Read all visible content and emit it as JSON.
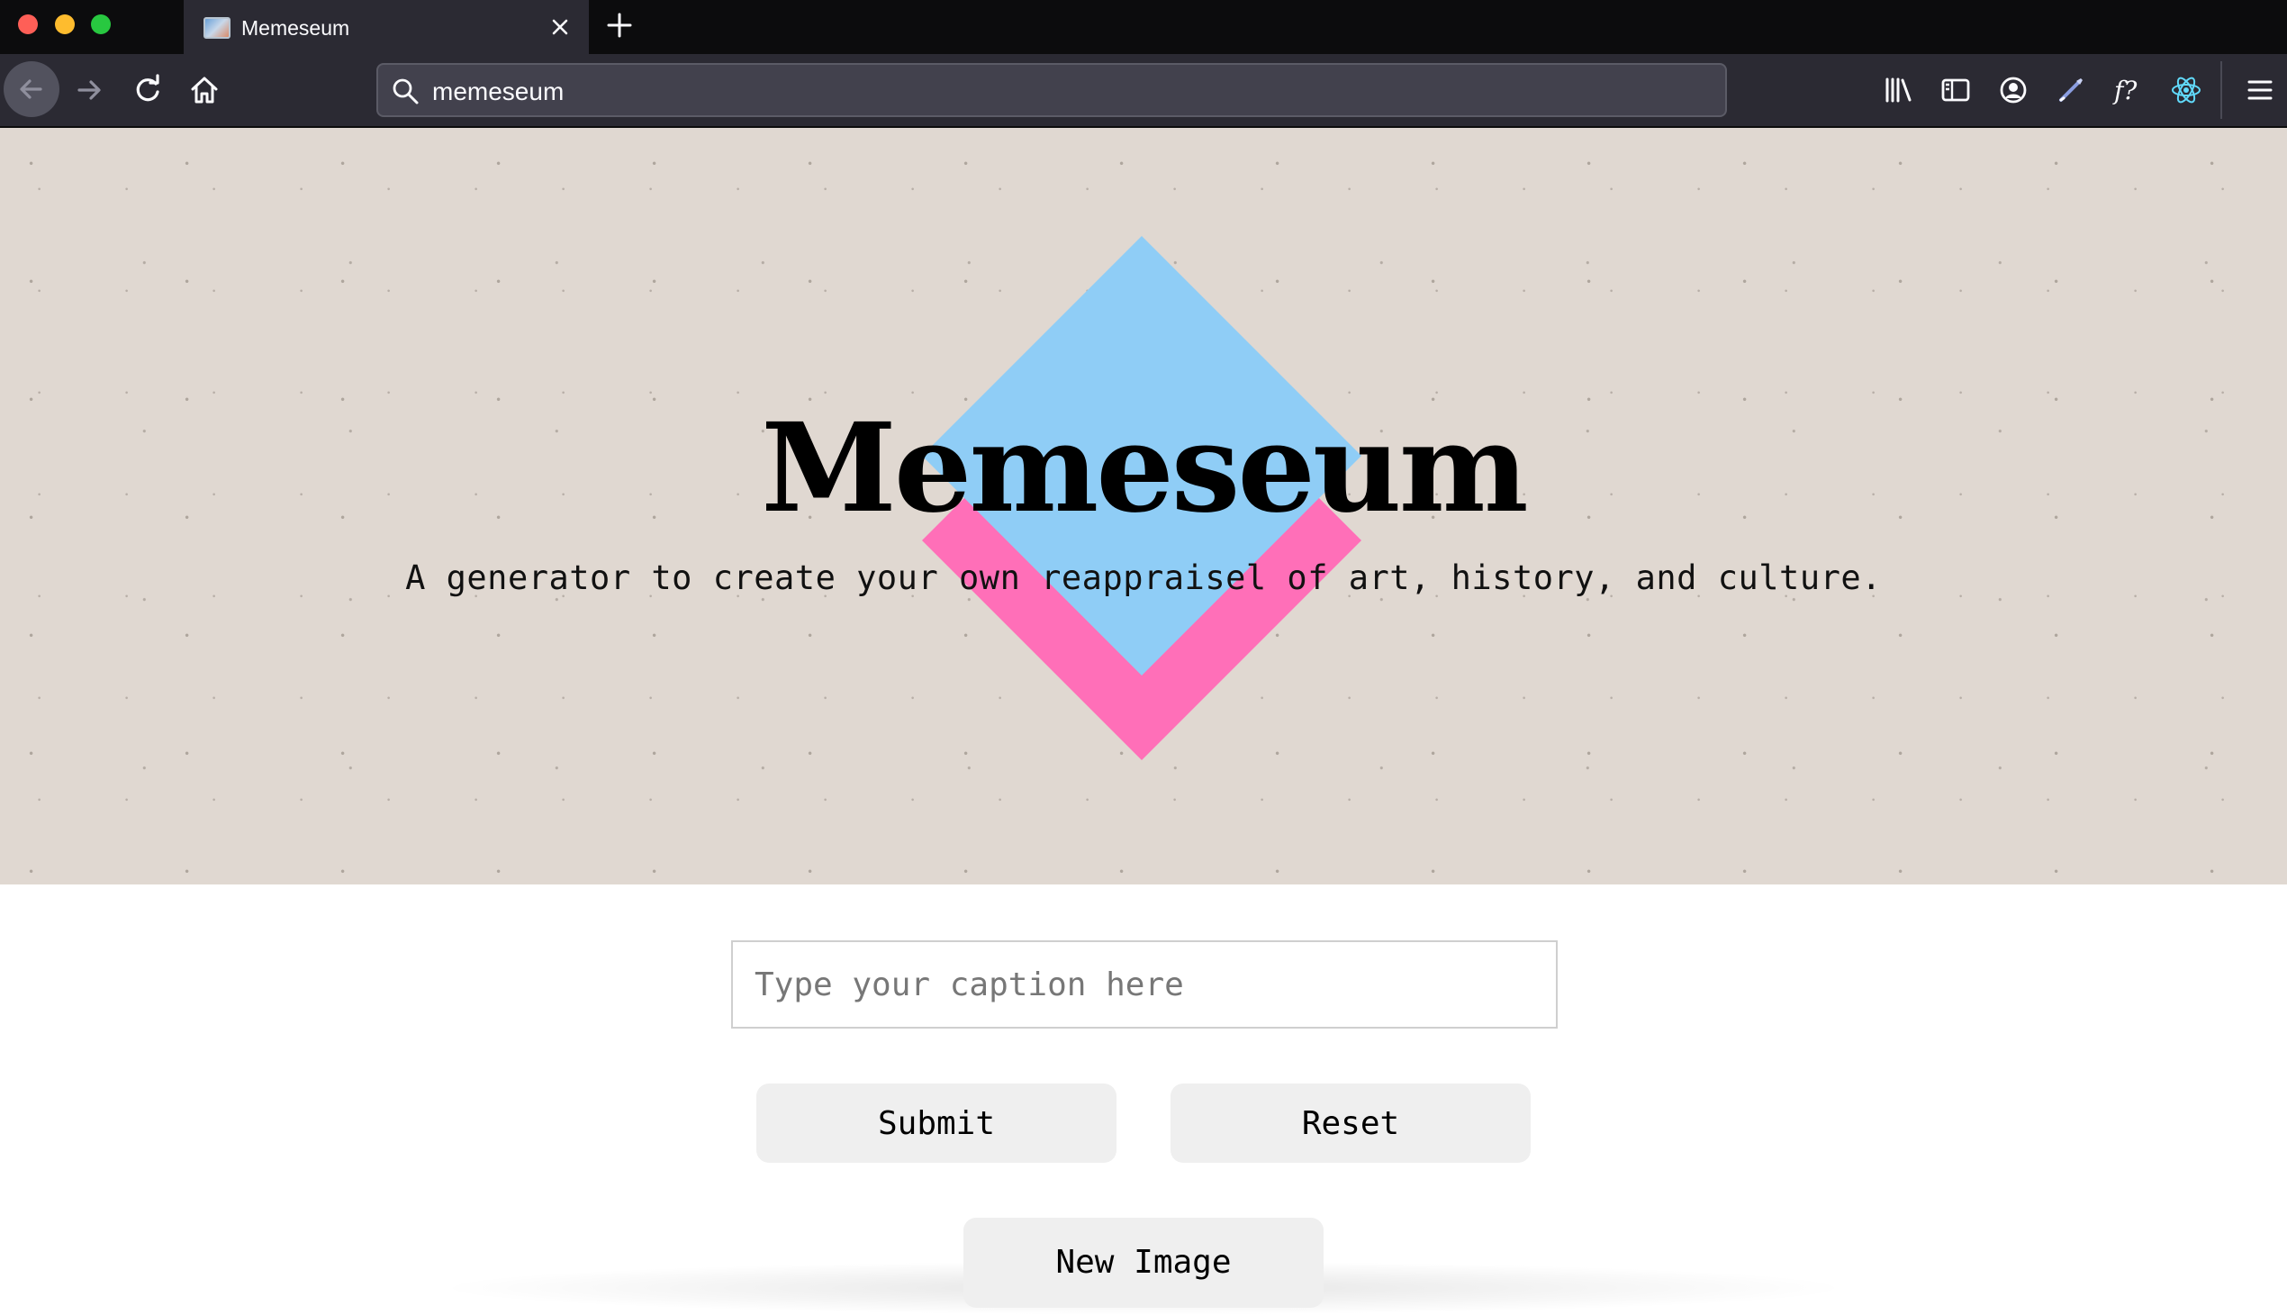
{
  "browser": {
    "tab": {
      "title": "Memeseum",
      "favicon": "image-favicon-icon"
    },
    "urlbar": {
      "value": "memeseum"
    },
    "toolbar_icons": [
      "library-icon",
      "sidebar-icon",
      "account-icon",
      "eyedropper-icon",
      "font-finder-icon",
      "react-devtools-icon",
      "menu-icon"
    ]
  },
  "page": {
    "hero": {
      "title": "Memeseum",
      "tagline": "A generator to create your own reappraisel of art, history, and culture."
    },
    "form": {
      "caption_placeholder": "Type your caption here",
      "submit_label": "Submit",
      "reset_label": "Reset",
      "new_image_label": "New Image"
    },
    "colors": {
      "diamond_blue": "#8fcdf6",
      "diamond_pink": "#ff6fb8",
      "hero_background": "#e0d8d1",
      "button_background": "#efefef"
    }
  }
}
